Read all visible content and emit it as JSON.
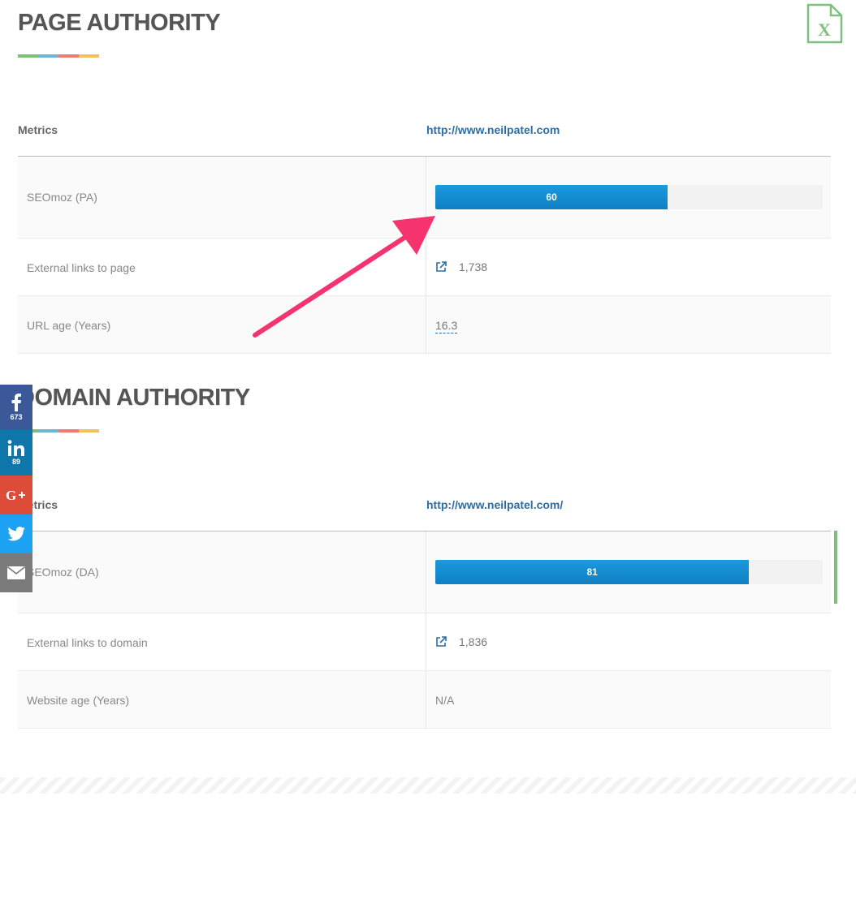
{
  "page_authority": {
    "title": "PAGE AUTHORITY",
    "header": {
      "metrics_label": "Metrics",
      "url": "http://www.neilpatel.com"
    },
    "rows": {
      "seomoz": {
        "label": "SEOmoz (PA)",
        "value": "60",
        "percent": 60
      },
      "external_links": {
        "label": "External links to page",
        "value": "1,738"
      },
      "url_age": {
        "label": "URL age (Years)",
        "value": "16.3"
      }
    }
  },
  "domain_authority": {
    "title": "DOMAIN AUTHORITY",
    "header": {
      "metrics_label": "Metrics",
      "url": "http://www.neilpatel.com/"
    },
    "rows": {
      "seomoz": {
        "label": "SEOmoz (DA)",
        "value": "81",
        "percent": 81
      },
      "external_links": {
        "label": "External links to domain",
        "value": "1,836"
      },
      "website_age": {
        "label": "Website age (Years)",
        "value": "N/A"
      }
    }
  },
  "social": {
    "facebook": {
      "icon": "facebook-icon",
      "count": "673",
      "color": "#3b5998"
    },
    "linkedin": {
      "icon": "linkedin-icon",
      "count": "89",
      "color": "#0e76a8"
    },
    "googleplus": {
      "icon": "google-plus-icon",
      "color": "#dd4b39"
    },
    "twitter": {
      "icon": "twitter-icon",
      "color": "#1da1f2"
    },
    "email": {
      "icon": "email-icon",
      "color": "#7a7a7a"
    }
  },
  "colors": {
    "title_bar": [
      "#7cc07a",
      "#6fb3d8",
      "#f07b72",
      "#f3c15a"
    ],
    "bar_fill": "#1589cf",
    "link": "#2e6da4",
    "arrow": "#f5336f",
    "excel_icon": "#7dc07f"
  }
}
